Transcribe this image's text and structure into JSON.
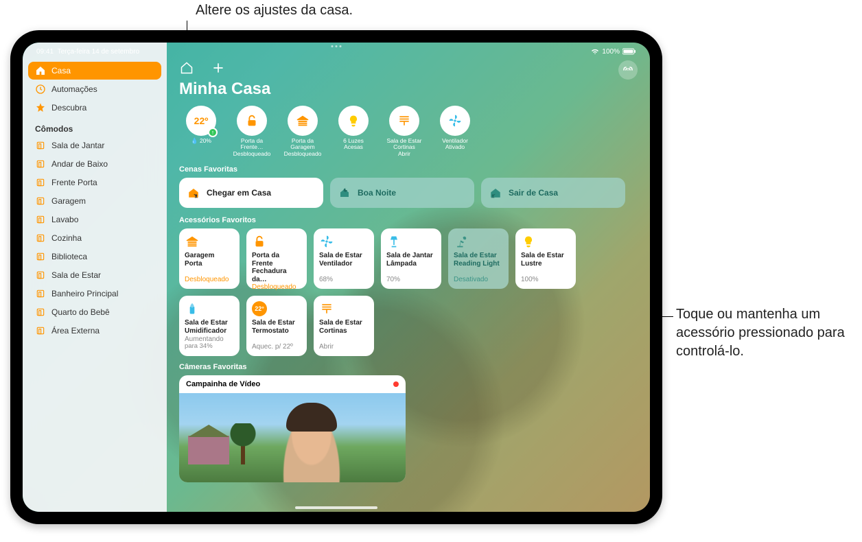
{
  "callouts": {
    "top": "Altere os ajustes da casa.",
    "right": "Toque ou mantenha um acessório pressionado para controlá-lo."
  },
  "statusbar": {
    "time": "09:41",
    "date": "Terça-feira 14 de setembro",
    "wifi": "wifi",
    "battery_pct": "100%"
  },
  "sidebar": {
    "items": [
      {
        "label": "Casa",
        "icon": "home",
        "active": true
      },
      {
        "label": "Automações",
        "icon": "clock",
        "active": false
      },
      {
        "label": "Descubra",
        "icon": "star",
        "active": false
      }
    ],
    "rooms_title": "Cômodos",
    "rooms": [
      "Sala de Jantar",
      "Andar de Baixo",
      "Frente Porta",
      "Garagem",
      "Lavabo",
      "Cozinha",
      "Biblioteca",
      "Sala de Estar",
      "Banheiro Principal",
      "Quarto do Bebê",
      "Área Externa"
    ]
  },
  "main": {
    "title": "Minha Casa",
    "climate": {
      "temp": "22º",
      "humidity": "20%"
    },
    "status_chips": [
      {
        "line1": "Porta da Frente…",
        "line2": "Desbloqueado",
        "icon": "lock"
      },
      {
        "line1": "Porta da Garagem",
        "line2": "Desbloqueado",
        "icon": "garage"
      },
      {
        "line1": "6 Luzes",
        "line2": "Acesas",
        "icon": "bulb"
      },
      {
        "line1": "Sala de Estar Cortinas",
        "line2": "Abrir",
        "icon": "blinds"
      },
      {
        "line1": "Ventilador",
        "line2": "Ativado",
        "icon": "fan"
      }
    ],
    "scenes_title": "Cenas Favoritas",
    "scenes": [
      {
        "name": "Chegar em Casa",
        "style": "light",
        "icon": "arrive"
      },
      {
        "name": "Boa Noite",
        "style": "teal",
        "icon": "moon"
      },
      {
        "name": "Sair de Casa",
        "style": "teal",
        "icon": "leave"
      }
    ],
    "accessories_title": "Acessórios Favoritos",
    "accessories": [
      {
        "l1": "Garagem",
        "l2": "Porta",
        "l3": "Desbloqueado",
        "l3_color": "orange",
        "icon": "garage",
        "off": false
      },
      {
        "l1": "Porta da Frente",
        "l2": "Fechadura da…",
        "l3": "Desbloqueado",
        "l3_color": "orange",
        "icon": "lock",
        "off": false
      },
      {
        "l1": "Sala de Estar",
        "l2": "Ventilador",
        "l3": "68%",
        "icon": "fan",
        "off": false
      },
      {
        "l1": "Sala de Jantar",
        "l2": "Lâmpada",
        "l3": "70%",
        "icon": "lamp",
        "off": false
      },
      {
        "l1": "Sala de Estar",
        "l2": "Reading Light",
        "l3": "Desativado",
        "icon": "desk-lamp",
        "off": true
      },
      {
        "l1": "Sala de Estar",
        "l2": "Lustre",
        "l3": "100%",
        "icon": "bulb",
        "off": false
      },
      {
        "l1": "Sala de Estar",
        "l2": "Umidificador",
        "l3": "Aumentando",
        "l4": "para 34%",
        "icon": "humidifier",
        "off": false
      },
      {
        "l1": "Sala de Estar",
        "l2": "Termostato",
        "l3": "Aquec. p/ 22º",
        "icon": "thermostat",
        "off": false,
        "badge": "22°"
      },
      {
        "l1": "Sala de Estar",
        "l2": "Cortinas",
        "l3": "Abrir",
        "icon": "blinds",
        "off": false
      }
    ],
    "cameras_title": "Câmeras Favoritas",
    "camera": {
      "name": "Campainha de Vídeo"
    }
  }
}
